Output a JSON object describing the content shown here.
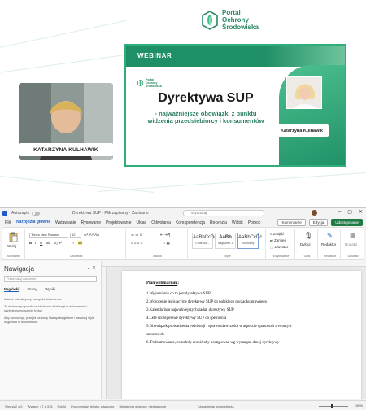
{
  "brand": {
    "logo_line1": "Portal",
    "logo_line2": "Ochrony",
    "logo_line3": "Środowiska"
  },
  "webcam": {
    "speaker_name": "KATARZYNA KULHAWIK"
  },
  "slide": {
    "label": "WEBINAR",
    "small_logo_line1": "Portal",
    "small_logo_line2": "Ochrony",
    "small_logo_line3": "Środowiska",
    "title": "Dyrektywa SUP",
    "subtitle_line1": "- najważniejsze obowiązki z punktu",
    "subtitle_line2": "widzenia przedsiębiorcy i konsumentów",
    "speaker_name": "Katarzyna Kulhawik"
  },
  "word": {
    "autosave_label": "Autozapis",
    "doc_title": "Dyrektywa SUP · Plik zapisany · Zapisano",
    "search_placeholder": "Wyszukaj",
    "menu": [
      "Plik",
      "Narzędzia główne",
      "Wstawianie",
      "Rysowanie",
      "Projektowanie",
      "Układ",
      "Odwołania",
      "Korespondencja",
      "Recenzja",
      "Widok",
      "Pomoc"
    ],
    "menu_active_index": 1,
    "comments_label": "Komentarze",
    "editing_label": "Edycja",
    "share_label": "Udostępnianie",
    "ribbon": {
      "paste_label": "Wklej",
      "clipboard_group": "Schowek",
      "font_name": "Times New Roman",
      "font_size": "12",
      "font_group": "Czcionka",
      "paragraph_group": "Akapit",
      "styles": [
        {
          "sample": "AaBbCcDc",
          "name": "Cytat wia..."
        },
        {
          "sample": "AaBb",
          "name": "Nagłówek 1"
        },
        {
          "sample": "AaBbCcDc",
          "name": "Normalny"
        }
      ],
      "styles_group": "Style",
      "find_label": "Znajdź",
      "replace_label": "Zamień",
      "select_label": "Zaznacz",
      "editing_group": "Edytowanie",
      "dictate_label": "Dyktuj",
      "voice_group": "Głos",
      "editor_label": "Redaktor",
      "editor_group": "Redaktor",
      "addins_label": "Dodatki",
      "addins_group": "Dodatki"
    },
    "nav": {
      "title": "Nawigacja",
      "search_placeholder": "Przeszukaj dokument",
      "tabs": [
        "Nagłówki",
        "Strony",
        "Wyniki"
      ],
      "help": [
        "Utwórz interaktywny konspekt dokumentu.",
        "To doskonały sposób na śledzenie lokalizacji w dokumencie i szybkie przenoszenie treści.",
        "Aby rozpocząć, przejdź na kartę Narzędzia główne i zastosuj style nagłówka w dokumencie."
      ]
    },
    "document": {
      "heading_prefix": "Plan ",
      "heading_underlined": "webinarium",
      "heading_suffix": ":",
      "items": [
        "1.Wyjaśnienie co to jest dyrektywa SUP",
        "2.Wdrożenie legislacyjne dyrektywy SUP do polskiego porządku prawnego",
        "3.Kalendarium najważniejszych zadań dyrektywy SUP",
        "4.Cele szczegółowe dyrektywy SUP do spełnienia",
        "5.Obowiązek prowadzenia ewidencji i sprawozdawczości w aspekcie opakowań z tworzyw",
        "sztucznych",
        "6. Podsumowanie, co należy zrobić aby postępować wg wymagań danej dyrektywy"
      ]
    },
    "status": {
      "page": "Strona 2 z 2",
      "words": "Wyrazy: 47 z 378",
      "language": "Polski",
      "predictions": "Podpowiedzi tekstu: włączone",
      "accessibility": "Ułatwienia dostępu: niedostępne",
      "focus": "Ustawienia wyświetlania",
      "zoom": "100%"
    }
  }
}
